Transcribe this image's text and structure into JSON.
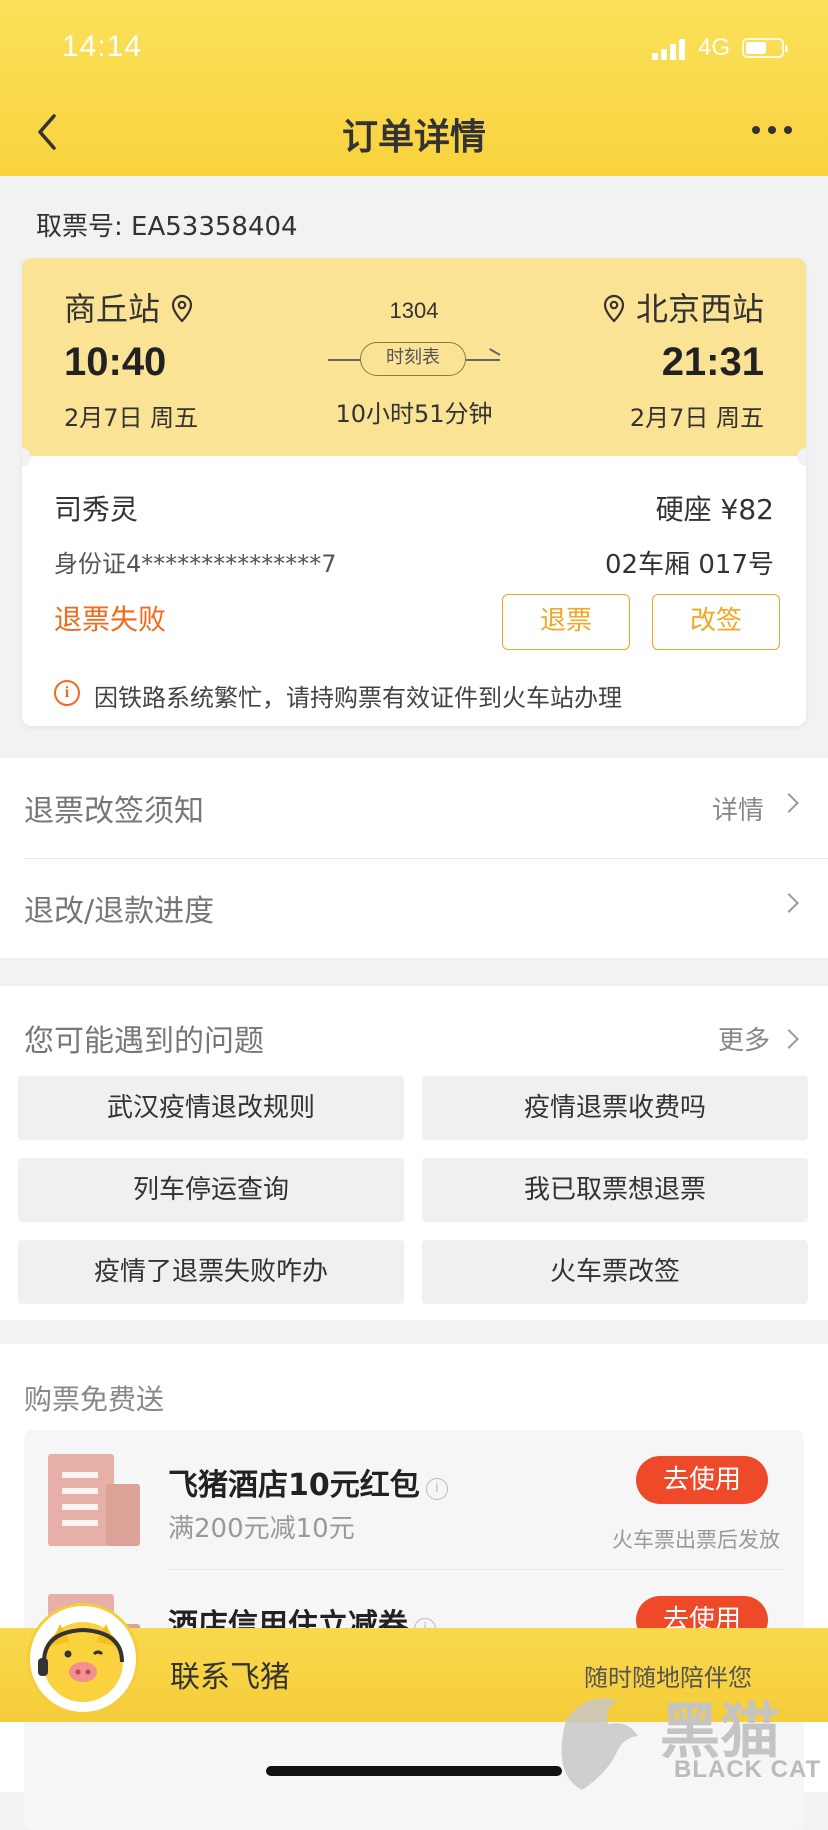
{
  "status_bar": {
    "time": "14:14",
    "network": "4G"
  },
  "nav": {
    "title": "订单详情"
  },
  "ticket": {
    "pickup_label": "取票号: EA53358404",
    "from_station": "商丘站",
    "to_station": "北京西站",
    "train_no": "1304",
    "depart_time": "10:40",
    "arrive_time": "21:31",
    "depart_date": "2月7日 周五",
    "arrive_date": "2月7日 周五",
    "timetable_label": "时刻表",
    "duration": "10小时51分钟",
    "passenger_name": "司秀灵",
    "seat_price": "硬座 ¥82",
    "id_card": "身份证4***************7",
    "seat_no": "02车厢 017号",
    "refund_status": "退票失败",
    "refund_button": "退票",
    "change_button": "改签",
    "notice": "因铁路系统繁忙，请持购票有效证件到火车站办理"
  },
  "list": {
    "rules_label": "退票改签须知",
    "rules_detail": "详情",
    "progress_label": "退改/退款进度"
  },
  "faq": {
    "title": "您可能遇到的问题",
    "more": "更多",
    "items": [
      "武汉疫情退改规则",
      "疫情退票收费吗",
      "列车停运查询",
      "我已取票想退票",
      "疫情了退票失败咋办",
      "火车票改签"
    ]
  },
  "promo": {
    "title": "购票免费送",
    "coupons": [
      {
        "name": "飞猪酒店10元红包",
        "desc": "满200元减10元",
        "button": "去使用",
        "sub": "火车票出票后发放"
      },
      {
        "name": "酒店信用住立减券",
        "button": "去使用"
      }
    ]
  },
  "contact": {
    "label": "联系飞猪",
    "sub": "随时随地陪伴您"
  },
  "watermark": {
    "text": "BLACK CAT"
  },
  "colors": {
    "header": "#f9d23e",
    "ticket_top": "#fbe396",
    "accent_orange": "#f5a623",
    "status_red": "#f26a1b",
    "use_button": "#ee4a2a"
  }
}
